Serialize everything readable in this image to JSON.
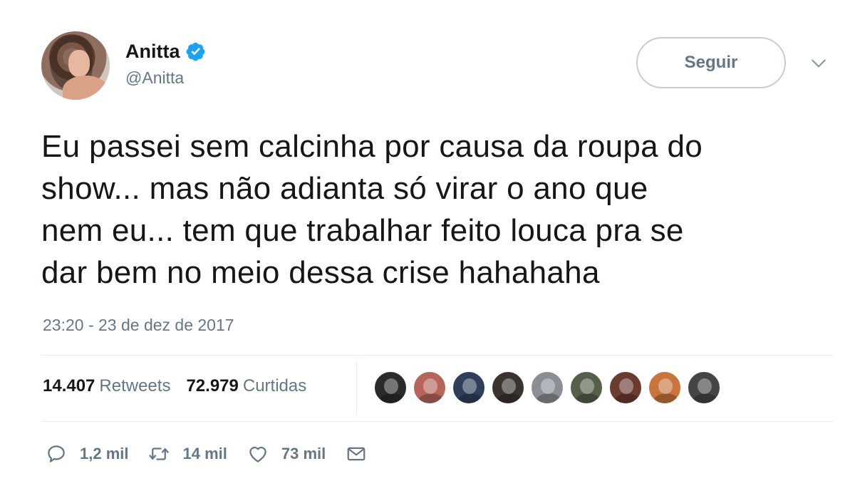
{
  "user": {
    "display_name": "Anitta",
    "handle": "@Anitta",
    "verified": true,
    "verified_color": "#1da1f2"
  },
  "follow_button": {
    "label": "Seguir"
  },
  "tweet": {
    "lines": [
      "Eu passei sem calcinha por causa da roupa do",
      "show... mas não adianta só virar o ano que",
      "nem eu... tem que trabalhar feito louca pra se",
      "dar bem no meio dessa crise hahahaha"
    ],
    "timestamp": "23:20 - 23 de dez de 2017"
  },
  "stats": {
    "retweets_count": "14.407",
    "retweets_label": "Retweets",
    "likes_count": "72.979",
    "likes_label": "Curtidas"
  },
  "likers": [
    {
      "icon": "avatar",
      "color": "#2b2b2b"
    },
    {
      "icon": "avatar",
      "color": "#b5655a"
    },
    {
      "icon": "avatar",
      "color": "#2f3f5a"
    },
    {
      "icon": "avatar",
      "color": "#3a3330"
    },
    {
      "icon": "avatar",
      "color": "#8a8f96"
    },
    {
      "icon": "avatar",
      "color": "#55604a"
    },
    {
      "icon": "avatar",
      "color": "#6b3a30"
    },
    {
      "icon": "avatar",
      "color": "#c9733d"
    },
    {
      "icon": "avatar",
      "color": "#454545"
    }
  ],
  "actions": {
    "reply": {
      "icon": "reply-icon",
      "count": "1,2 mil"
    },
    "retweet": {
      "icon": "retweet-icon",
      "count": "14 mil"
    },
    "like": {
      "icon": "heart-icon",
      "count": "73 mil"
    },
    "dm": {
      "icon": "envelope-icon"
    }
  }
}
